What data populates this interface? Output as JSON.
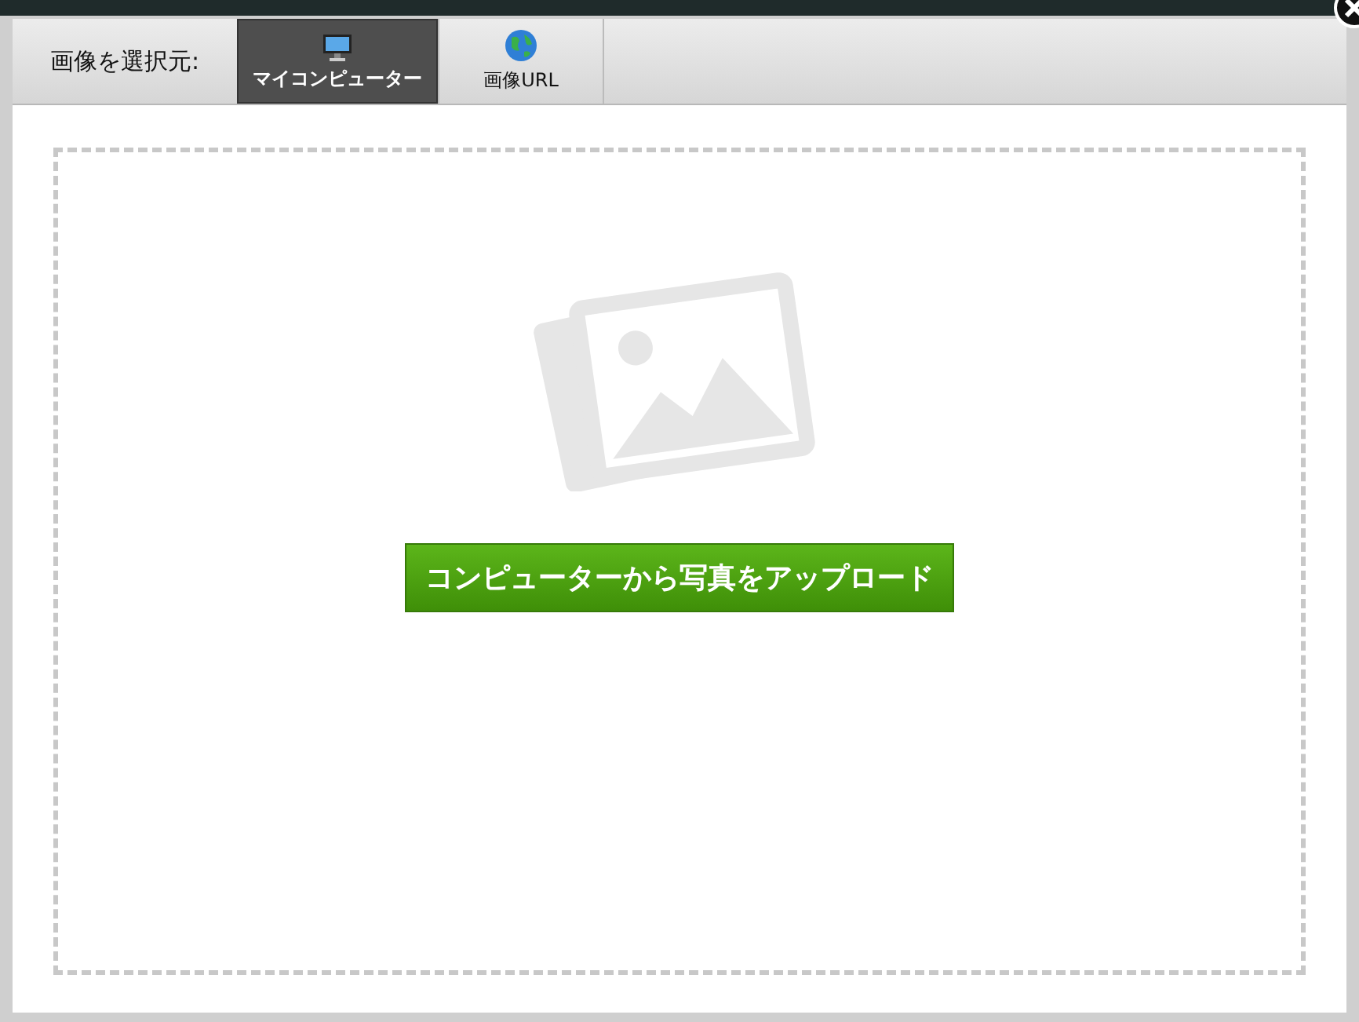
{
  "source_label": "画像を選択元:",
  "tabs": [
    {
      "label": "マイコンピューター",
      "selected": true
    },
    {
      "label": "画像URL",
      "selected": false
    }
  ],
  "upload_button": "コンピューターから写真をアップロード"
}
